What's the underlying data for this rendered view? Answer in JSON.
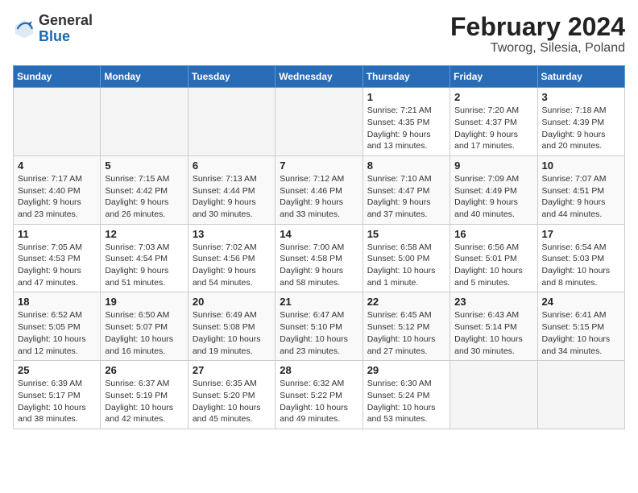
{
  "header": {
    "logo_general": "General",
    "logo_blue": "Blue",
    "title": "February 2024",
    "subtitle": "Tworog, Silesia, Poland"
  },
  "weekdays": [
    "Sunday",
    "Monday",
    "Tuesday",
    "Wednesday",
    "Thursday",
    "Friday",
    "Saturday"
  ],
  "weeks": [
    [
      {
        "day": "",
        "info": ""
      },
      {
        "day": "",
        "info": ""
      },
      {
        "day": "",
        "info": ""
      },
      {
        "day": "",
        "info": ""
      },
      {
        "day": "1",
        "info": "Sunrise: 7:21 AM\nSunset: 4:35 PM\nDaylight: 9 hours\nand 13 minutes."
      },
      {
        "day": "2",
        "info": "Sunrise: 7:20 AM\nSunset: 4:37 PM\nDaylight: 9 hours\nand 17 minutes."
      },
      {
        "day": "3",
        "info": "Sunrise: 7:18 AM\nSunset: 4:39 PM\nDaylight: 9 hours\nand 20 minutes."
      }
    ],
    [
      {
        "day": "4",
        "info": "Sunrise: 7:17 AM\nSunset: 4:40 PM\nDaylight: 9 hours\nand 23 minutes."
      },
      {
        "day": "5",
        "info": "Sunrise: 7:15 AM\nSunset: 4:42 PM\nDaylight: 9 hours\nand 26 minutes."
      },
      {
        "day": "6",
        "info": "Sunrise: 7:13 AM\nSunset: 4:44 PM\nDaylight: 9 hours\nand 30 minutes."
      },
      {
        "day": "7",
        "info": "Sunrise: 7:12 AM\nSunset: 4:46 PM\nDaylight: 9 hours\nand 33 minutes."
      },
      {
        "day": "8",
        "info": "Sunrise: 7:10 AM\nSunset: 4:47 PM\nDaylight: 9 hours\nand 37 minutes."
      },
      {
        "day": "9",
        "info": "Sunrise: 7:09 AM\nSunset: 4:49 PM\nDaylight: 9 hours\nand 40 minutes."
      },
      {
        "day": "10",
        "info": "Sunrise: 7:07 AM\nSunset: 4:51 PM\nDaylight: 9 hours\nand 44 minutes."
      }
    ],
    [
      {
        "day": "11",
        "info": "Sunrise: 7:05 AM\nSunset: 4:53 PM\nDaylight: 9 hours\nand 47 minutes."
      },
      {
        "day": "12",
        "info": "Sunrise: 7:03 AM\nSunset: 4:54 PM\nDaylight: 9 hours\nand 51 minutes."
      },
      {
        "day": "13",
        "info": "Sunrise: 7:02 AM\nSunset: 4:56 PM\nDaylight: 9 hours\nand 54 minutes."
      },
      {
        "day": "14",
        "info": "Sunrise: 7:00 AM\nSunset: 4:58 PM\nDaylight: 9 hours\nand 58 minutes."
      },
      {
        "day": "15",
        "info": "Sunrise: 6:58 AM\nSunset: 5:00 PM\nDaylight: 10 hours\nand 1 minute."
      },
      {
        "day": "16",
        "info": "Sunrise: 6:56 AM\nSunset: 5:01 PM\nDaylight: 10 hours\nand 5 minutes."
      },
      {
        "day": "17",
        "info": "Sunrise: 6:54 AM\nSunset: 5:03 PM\nDaylight: 10 hours\nand 8 minutes."
      }
    ],
    [
      {
        "day": "18",
        "info": "Sunrise: 6:52 AM\nSunset: 5:05 PM\nDaylight: 10 hours\nand 12 minutes."
      },
      {
        "day": "19",
        "info": "Sunrise: 6:50 AM\nSunset: 5:07 PM\nDaylight: 10 hours\nand 16 minutes."
      },
      {
        "day": "20",
        "info": "Sunrise: 6:49 AM\nSunset: 5:08 PM\nDaylight: 10 hours\nand 19 minutes."
      },
      {
        "day": "21",
        "info": "Sunrise: 6:47 AM\nSunset: 5:10 PM\nDaylight: 10 hours\nand 23 minutes."
      },
      {
        "day": "22",
        "info": "Sunrise: 6:45 AM\nSunset: 5:12 PM\nDaylight: 10 hours\nand 27 minutes."
      },
      {
        "day": "23",
        "info": "Sunrise: 6:43 AM\nSunset: 5:14 PM\nDaylight: 10 hours\nand 30 minutes."
      },
      {
        "day": "24",
        "info": "Sunrise: 6:41 AM\nSunset: 5:15 PM\nDaylight: 10 hours\nand 34 minutes."
      }
    ],
    [
      {
        "day": "25",
        "info": "Sunrise: 6:39 AM\nSunset: 5:17 PM\nDaylight: 10 hours\nand 38 minutes."
      },
      {
        "day": "26",
        "info": "Sunrise: 6:37 AM\nSunset: 5:19 PM\nDaylight: 10 hours\nand 42 minutes."
      },
      {
        "day": "27",
        "info": "Sunrise: 6:35 AM\nSunset: 5:20 PM\nDaylight: 10 hours\nand 45 minutes."
      },
      {
        "day": "28",
        "info": "Sunrise: 6:32 AM\nSunset: 5:22 PM\nDaylight: 10 hours\nand 49 minutes."
      },
      {
        "day": "29",
        "info": "Sunrise: 6:30 AM\nSunset: 5:24 PM\nDaylight: 10 hours\nand 53 minutes."
      },
      {
        "day": "",
        "info": ""
      },
      {
        "day": "",
        "info": ""
      }
    ]
  ]
}
